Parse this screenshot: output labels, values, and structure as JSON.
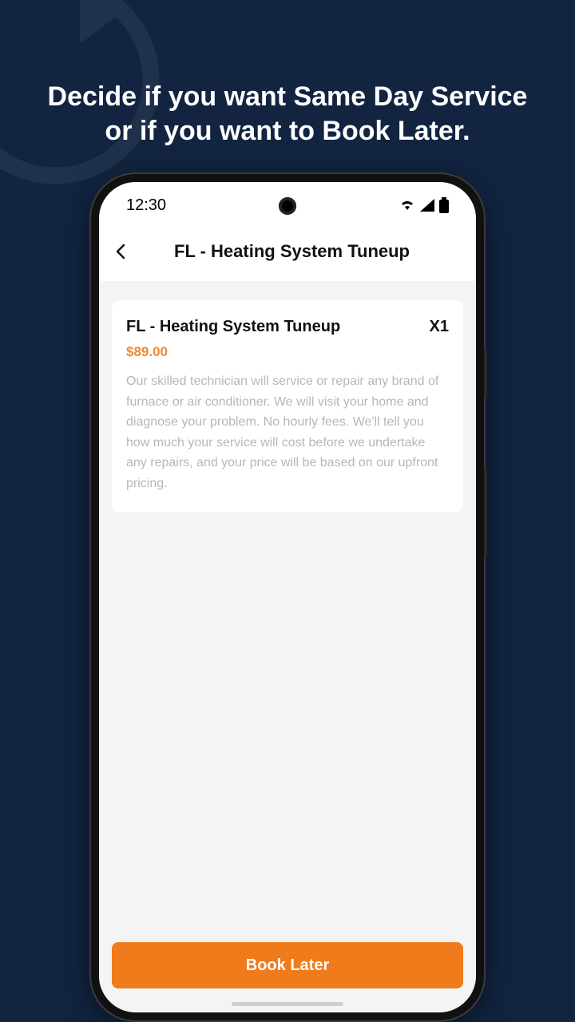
{
  "hero": {
    "text": "Decide if you want Same Day Service or if you want to Book Later."
  },
  "status_bar": {
    "time": "12:30"
  },
  "header": {
    "title": "FL - Heating System Tuneup"
  },
  "service_card": {
    "title": "FL - Heating System Tuneup",
    "quantity": "X1",
    "price": "$89.00",
    "description": "Our skilled technician will service or repair any brand of furnace or air conditioner. We will visit your home and diagnose your problem. No hourly fees. We'll tell you how much your service will cost before we undertake any repairs, and your price will be based on our upfront pricing."
  },
  "actions": {
    "book_later_label": "Book Later"
  }
}
